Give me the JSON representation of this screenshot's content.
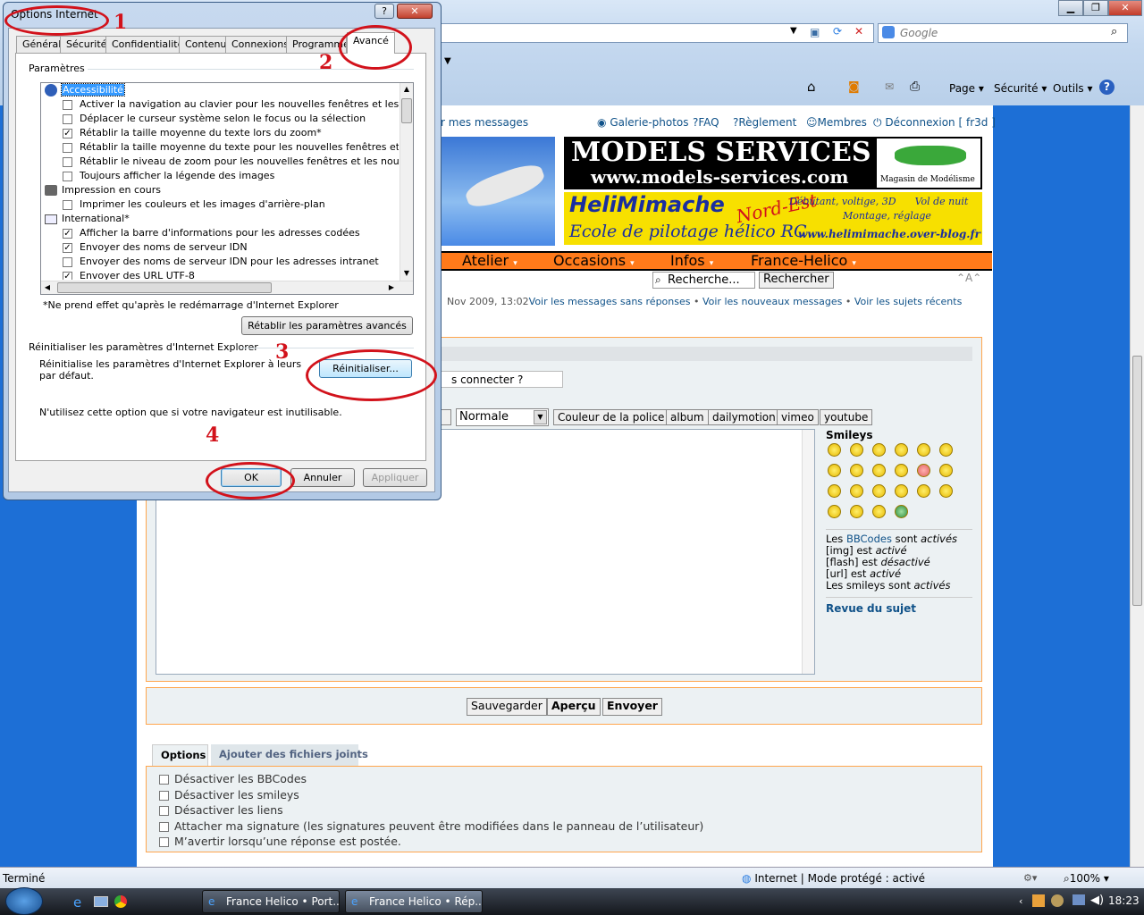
{
  "browser": {
    "search_placeholder": "Google",
    "toolbar": {
      "page": "Page",
      "security": "Sécurité",
      "tools": "Outils"
    }
  },
  "forum_nav": {
    "my_messages": "r mes messages",
    "gallery": "Galerie-photos",
    "faq": "FAQ",
    "rules": "Règlement",
    "members": "Membres",
    "logout": "Déconnexion [ fr3d ]"
  },
  "banners": {
    "models_title": "MODELS SERVICES",
    "models_url": "www.models-services.com",
    "models_tag": "Magasin de Modélisme",
    "heli_title": "HeliMimache",
    "heli_region": "Nord-Est",
    "heli_line1": "Débutant, voltige, 3D      Vol de nuit",
    "heli_line2": "Montage, réglage",
    "heli_school": "Ecole de pilotage hélico RC",
    "heli_url": "www.helimimache.over-blog.fr"
  },
  "menu": [
    "Atelier",
    "Occasions",
    "Infos",
    "France-Helico"
  ],
  "search": {
    "placeholder": "Recherche...",
    "button": "Rechercher"
  },
  "quicklinks": {
    "date": "Nov 2009, 13:02",
    "unanswered": "Voir les messages sans réponses",
    "new": "Voir les nouveaux messages",
    "recent": "Voir les sujets récents"
  },
  "login_hint": "s connecter ?",
  "editor": {
    "font_size": "Normale",
    "buttons": [
      "Couleur de la police",
      "album",
      "dailymotion",
      "vimeo",
      "youtube"
    ],
    "smileys_title": "Smileys",
    "bbcode_lines": [
      {
        "pre": "Les ",
        "link": "BBCodes",
        "mid": " sont ",
        "em": "activés"
      },
      {
        "pre": "[img] est ",
        "link": "",
        "mid": "",
        "em": "activé"
      },
      {
        "pre": "[flash] est ",
        "link": "",
        "mid": "",
        "em": "désactivé"
      },
      {
        "pre": "[url] est ",
        "link": "",
        "mid": "",
        "em": "activé"
      },
      {
        "pre": "Les smileys sont ",
        "link": "",
        "mid": "",
        "em": "activés"
      }
    ],
    "topic_review": "Revue du sujet"
  },
  "post_buttons": {
    "save": "Sauvegarder",
    "preview": "Aperçu",
    "send": "Envoyer"
  },
  "options": {
    "tab_options": "Options",
    "tab_attach": "Ajouter des fichiers joints",
    "items": [
      "Désactiver les BBCodes",
      "Désactiver les smileys",
      "Désactiver les liens",
      "Attacher ma signature (les signatures peuvent être modifiées dans le panneau de l’utilisateur)",
      "M’avertir lorsqu’une réponse est postée."
    ]
  },
  "dialog": {
    "title": "Options Internet",
    "tabs": [
      "Général",
      "Sécurité",
      "Confidentialité",
      "Contenu",
      "Connexions",
      "Programmes",
      "Avancé"
    ],
    "group_settings": "Paramètres",
    "settings": [
      {
        "type": "cat",
        "label": "Accessibilité",
        "selected": true
      },
      {
        "type": "cb",
        "checked": false,
        "label": "Activer la navigation au clavier pour les nouvelles fenêtres et les nouveaux"
      },
      {
        "type": "cb",
        "checked": false,
        "label": "Déplacer le curseur système selon le focus ou la sélection"
      },
      {
        "type": "cb",
        "checked": true,
        "label": "Rétablir la taille moyenne du texte lors du zoom*"
      },
      {
        "type": "cb",
        "checked": false,
        "label": "Rétablir la taille moyenne du texte pour les nouvelles fenêtres et les nouve"
      },
      {
        "type": "cb",
        "checked": false,
        "label": "Rétablir le niveau de zoom pour les nouvelles fenêtres et les nouveaux ong"
      },
      {
        "type": "cb",
        "checked": false,
        "label": "Toujours afficher la légende des images"
      },
      {
        "type": "cat",
        "label": "Impression en cours",
        "selected": false
      },
      {
        "type": "cb",
        "checked": false,
        "label": "Imprimer les couleurs et les images d'arrière-plan"
      },
      {
        "type": "cat",
        "label": "International*",
        "selected": false
      },
      {
        "type": "cb",
        "checked": true,
        "label": "Afficher la barre d'informations pour les adresses codées"
      },
      {
        "type": "cb",
        "checked": true,
        "label": "Envoyer des noms de serveur IDN"
      },
      {
        "type": "cb",
        "checked": false,
        "label": "Envoyer des noms de serveur IDN pour les adresses intranet"
      },
      {
        "type": "cb",
        "checked": true,
        "label": "Envoyer des URL UTF-8"
      }
    ],
    "restart_note": "*Ne prend effet qu'après le redémarrage d'Internet Explorer",
    "restore_advanced": "Rétablir les paramètres avancés",
    "group_reset": "Réinitialiser les paramètres d'Internet Explorer",
    "reset_desc_1": "Réinitialise les paramètres d'Internet Explorer à leurs",
    "reset_desc_2": "par défaut.",
    "reset_button": "Réinitialiser...",
    "reset_warning": "N'utilisez cette option que si votre navigateur est inutilisable.",
    "ok": "OK",
    "cancel": "Annuler",
    "apply": "Appliquer"
  },
  "annotations": [
    "1",
    "2",
    "3",
    "4"
  ],
  "status": {
    "left": "Terminé",
    "zone": "Internet | Mode protégé : activé",
    "zoom": "100%"
  },
  "taskbar": {
    "task1": "France Helico • Port...",
    "task2": "France Helico • Rép...",
    "clock": "18:23"
  }
}
